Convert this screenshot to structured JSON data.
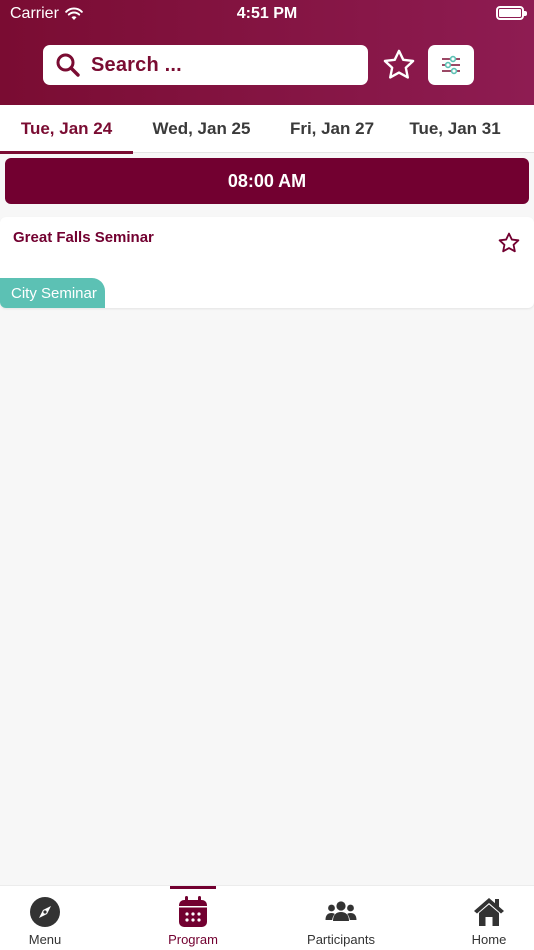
{
  "status_bar": {
    "carrier": "Carrier",
    "time": "4:51 PM"
  },
  "header": {
    "search_placeholder": "Search ...",
    "accent_color": "#7a0c32"
  },
  "date_tabs": [
    {
      "label": "Tue, Jan 24",
      "active": true
    },
    {
      "label": "Wed, Jan 25",
      "active": false
    },
    {
      "label": "Fri, Jan 27",
      "active": false
    },
    {
      "label": "Tue, Jan 31",
      "active": false
    }
  ],
  "schedule": {
    "time_slot": "08:00 AM",
    "sessions": [
      {
        "title": "Great Falls Seminar",
        "tag": "City Seminar",
        "tag_color": "#5cc1b4"
      }
    ]
  },
  "bottom_nav": [
    {
      "label": "Menu",
      "icon": "compass-icon",
      "active": false
    },
    {
      "label": "Program",
      "icon": "calendar-icon",
      "active": true
    },
    {
      "label": "Participants",
      "icon": "people-icon",
      "active": false
    },
    {
      "label": "Home",
      "icon": "home-icon",
      "active": false
    }
  ]
}
